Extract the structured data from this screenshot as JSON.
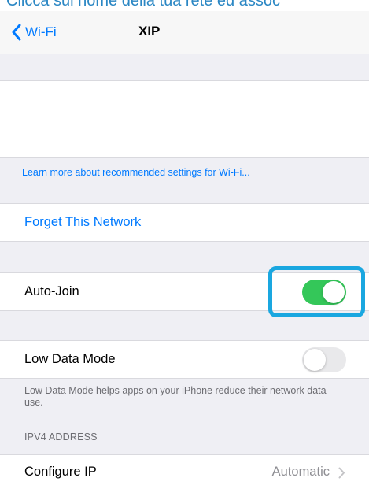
{
  "caption": {
    "text": "Clicca sul nome della tua rete ed assoc"
  },
  "nav": {
    "back_label": "Wi-Fi",
    "title": "XIP"
  },
  "learn_more": {
    "text": "Learn more about recommended settings for Wi-Fi..."
  },
  "forget": {
    "label": "Forget This Network"
  },
  "auto_join": {
    "label": "Auto-Join",
    "enabled": true
  },
  "low_data_mode": {
    "label": "Low Data Mode",
    "enabled": false,
    "footer": "Low Data Mode helps apps on your iPhone reduce their network data use."
  },
  "ipv4": {
    "header": "IPV4 ADDRESS",
    "configure_label": "Configure IP",
    "configure_value": "Automatic"
  },
  "colors": {
    "accent": "#007aff",
    "toggle_on": "#34c759",
    "toggle_off": "#e9e9eb",
    "highlight": "#1aa7e0",
    "caption": "#2b87c4"
  },
  "icons": {
    "back": "chevron-left-icon",
    "disclosure": "chevron-right-icon"
  }
}
